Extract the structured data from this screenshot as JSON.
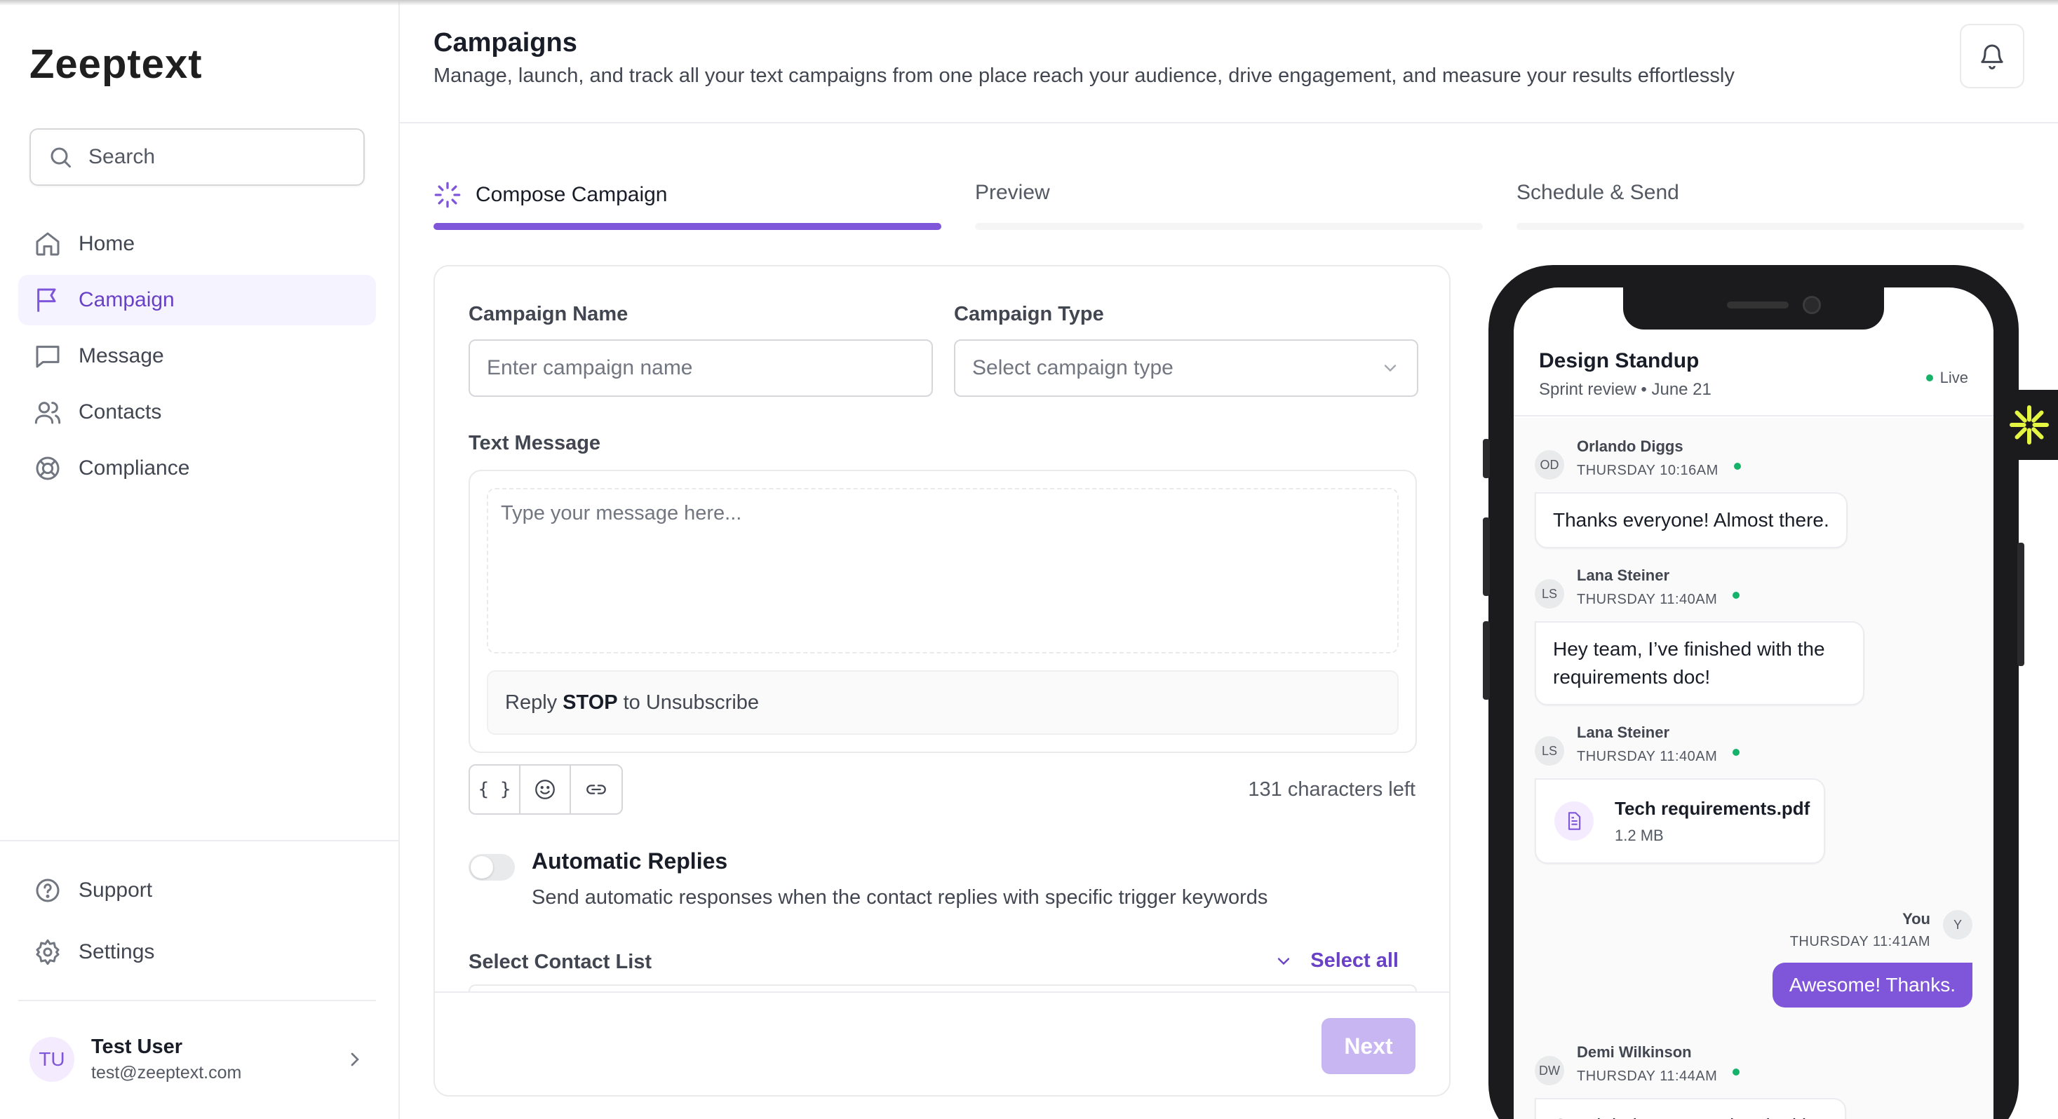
{
  "app": {
    "name": "Zeeptext"
  },
  "search": {
    "placeholder": "Search"
  },
  "nav": {
    "items": [
      {
        "label": "Home",
        "icon": "home-icon"
      },
      {
        "label": "Campaign",
        "icon": "flag-icon",
        "active": true
      },
      {
        "label": "Message",
        "icon": "message-icon"
      },
      {
        "label": "Contacts",
        "icon": "users-icon"
      },
      {
        "label": "Compliance",
        "icon": "lifebuoy-icon"
      }
    ],
    "bottom": [
      {
        "label": "Support",
        "icon": "help-circle-icon"
      },
      {
        "label": "Settings",
        "icon": "gear-icon"
      }
    ]
  },
  "user": {
    "initials": "TU",
    "name": "Test User",
    "email": "test@zeeptext.com"
  },
  "header": {
    "title": "Campaigns",
    "subtitle": "Manage, launch, and track all your text campaigns from one place reach your audience, drive engagement, and measure your results effortlessly"
  },
  "steps": [
    {
      "label": "Compose Campaign",
      "active": true
    },
    {
      "label": "Preview",
      "active": false
    },
    {
      "label": "Schedule & Send",
      "active": false
    }
  ],
  "form": {
    "campaign_name_label": "Campaign Name",
    "campaign_name_placeholder": "Enter campaign name",
    "campaign_type_label": "Campaign Type",
    "campaign_type_placeholder": "Select campaign type",
    "text_message_label": "Text Message",
    "message_placeholder": "Type your message here...",
    "reply_prefix": "Reply",
    "reply_keyword": "STOP",
    "reply_suffix": "to Unsubscribe",
    "toolbar": {
      "variables": "{ }"
    },
    "chars_left": "131 characters left",
    "auto_replies_title": "Automatic Replies",
    "auto_replies_desc": "Send automatic responses when the contact replies with specific trigger keywords",
    "auto_replies_enabled": false,
    "contact_list_label": "Select Contact List",
    "select_all": "Select all",
    "next": "Next"
  },
  "phone": {
    "chat_title": "Design Standup",
    "chat_sub_left": "Sprint review",
    "chat_sub_sep": "•",
    "chat_sub_right": "June 21",
    "live": "Live",
    "messages": [
      {
        "initials": "OD",
        "sender": "Orlando Diggs",
        "time": "THURSDAY 10:16AM",
        "text": "Thanks everyone! Almost there."
      },
      {
        "initials": "LS",
        "sender": "Lana Steiner",
        "time": "THURSDAY 11:40AM",
        "text": "Hey team, I’ve finished with the requirements doc!"
      },
      {
        "initials": "LS",
        "sender": "Lana Steiner",
        "time": "THURSDAY 11:40AM",
        "file_name": "Tech requirements.pdf",
        "file_size": "1.2 MB"
      },
      {
        "initials": "Y",
        "sender": "You",
        "time": "THURSDAY 11:41AM",
        "text": "Awesome! Thanks."
      },
      {
        "initials": "DW",
        "sender": "Demi Wilkinson",
        "time": "THURSDAY 11:44AM",
        "text": "Good timing — was just looking"
      }
    ]
  },
  "colors": {
    "accent": "#7f56d9",
    "accent_text": "#6941c6",
    "online": "#17b26a",
    "next_disabled": "#c8b6f3"
  }
}
